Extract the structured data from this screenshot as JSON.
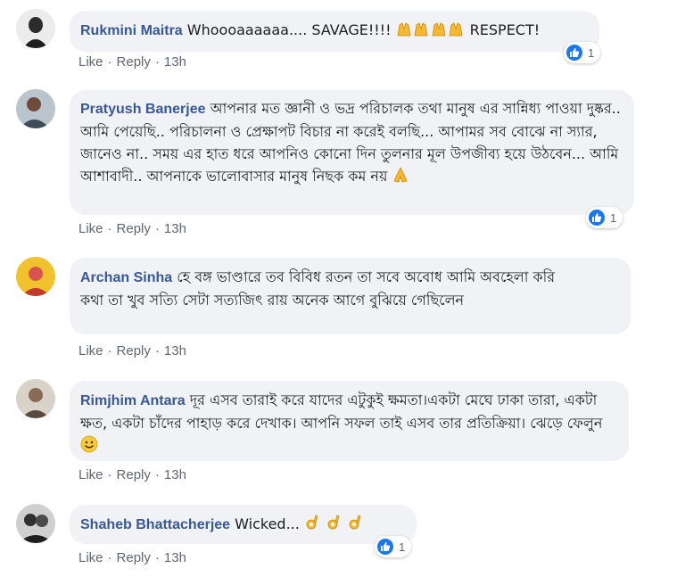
{
  "comments": [
    {
      "author": "Rukmini Maitra",
      "text": "Whoooaaaaaa.... SAVAGE!!!! ",
      "text_after_emoji": " RESPECT!",
      "emoji": "raised-hands",
      "like_label": "Like",
      "reply_label": "Reply",
      "time": "13h",
      "reaction_count": "1"
    },
    {
      "author": "Pratyush Banerjee",
      "text": "আপনার মত জ্ঞানী ও ভদ্র পরিচালক তথা মানুষ এর সান্নিধ্য পাওয়া দুষ্কর.. আমি পেয়েছি.. পরিচালনা ও প্রেক্ষাপট বিচার না করেই বলছি... আপামর সব বোঝে না স্যার, জানেও না.. সময় এর হাত ধরে আপনিও কোনো দিন তুলনার মূল উপজীব্য হয়ে উঠবেন... আমি আশাবাদী.. আপনাকে ভালোবাসার মানুষ নিছক কম নয় ",
      "emoji": "folded-hands",
      "like_label": "Like",
      "reply_label": "Reply",
      "time": "13h",
      "reaction_count": "1"
    },
    {
      "author": "Archan Sinha",
      "text": "হে বঙ্গ ভাণ্ডারে তব বিবিধ রতন তা সবে অবোধ আমি অবহেলা করি",
      "text_line2": "কথা তা খুব সত্যি সেটা সত্যজিৎ রায় অনেক আগে বুঝিয়ে গেছিলেন",
      "like_label": "Like",
      "reply_label": "Reply",
      "time": "13h"
    },
    {
      "author": "Rimjhim Antara",
      "text": "দূর এসব তারাই করে যাদের এটুকুই ক্ষমতা।একটা মেঘে ঢাকা তারা, একটা ক্ষত, একটা চাঁদের পাহাড় করে দেখাক। আপনি সফল তাই এসব তার প্রতিক্রিয়া। ঝেড়ে ফেলুন ",
      "emoji": "smiling-face",
      "like_label": "Like",
      "reply_label": "Reply",
      "time": "13h"
    },
    {
      "author": "Shaheb Bhattacherjee",
      "text": "Wicked... ",
      "emoji": "ok-hand",
      "like_label": "Like",
      "reply_label": "Reply",
      "time": "13h",
      "reaction_count": "1"
    }
  ],
  "colors": {
    "author": "#385898",
    "bubble": "#f0f2f5",
    "meta": "#606770",
    "like_blue": "#1877f2"
  }
}
